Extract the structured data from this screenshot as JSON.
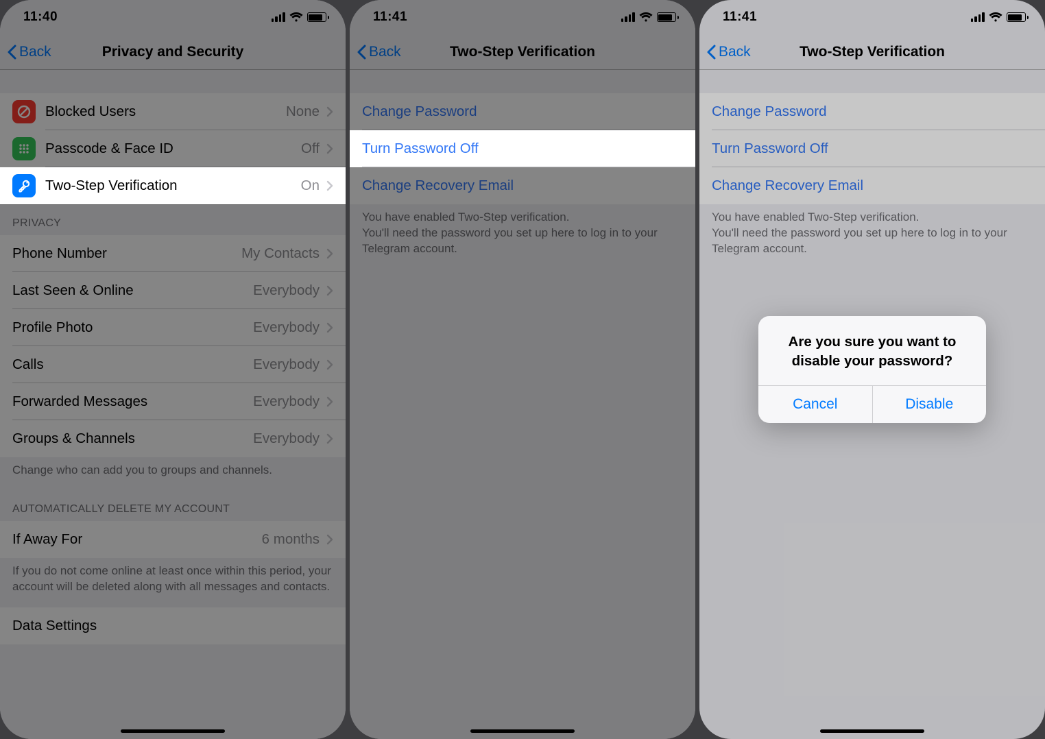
{
  "screen1": {
    "time": "11:40",
    "back": "Back",
    "title": "Privacy and Security",
    "sec1": {
      "blocked": {
        "label": "Blocked Users",
        "value": "None"
      },
      "passcode": {
        "label": "Passcode & Face ID",
        "value": "Off"
      },
      "twostep": {
        "label": "Two-Step Verification",
        "value": "On"
      }
    },
    "privacy_header": "PRIVACY",
    "privacy": {
      "phone": {
        "label": "Phone Number",
        "value": "My Contacts"
      },
      "lastseen": {
        "label": "Last Seen & Online",
        "value": "Everybody"
      },
      "photo": {
        "label": "Profile Photo",
        "value": "Everybody"
      },
      "calls": {
        "label": "Calls",
        "value": "Everybody"
      },
      "fwd": {
        "label": "Forwarded Messages",
        "value": "Everybody"
      },
      "groups": {
        "label": "Groups & Channels",
        "value": "Everybody"
      }
    },
    "privacy_footer": "Change who can add you to groups and channels.",
    "delete_header": "AUTOMATICALLY DELETE MY ACCOUNT",
    "delete": {
      "ifaway": {
        "label": "If Away For",
        "value": "6 months"
      }
    },
    "delete_footer": "If you do not come online at least once within this period, your account will be deleted along with all messages and contacts.",
    "data_settings": "Data Settings"
  },
  "screen2": {
    "time": "11:41",
    "back": "Back",
    "title": "Two-Step Verification",
    "change_pw": "Change Password",
    "turn_off": "Turn Password Off",
    "change_email": "Change Recovery Email",
    "footer": "You have enabled Two-Step verification.\nYou'll need the password you set up here to log in to your Telegram account."
  },
  "screen3": {
    "time": "11:41",
    "back": "Back",
    "title": "Two-Step Verification",
    "change_pw": "Change Password",
    "turn_off": "Turn Password Off",
    "change_email": "Change Recovery Email",
    "footer": "You have enabled Two-Step verification.\nYou'll need the password you set up here to log in to your Telegram account.",
    "alert": {
      "title": "Are you sure you want to disable your password?",
      "cancel": "Cancel",
      "disable": "Disable"
    }
  }
}
